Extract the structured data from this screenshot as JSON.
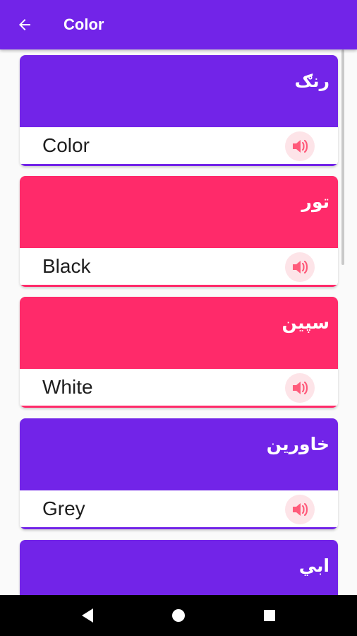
{
  "app_bar": {
    "title": "Color",
    "back_icon": "arrow-left-icon"
  },
  "colors": {
    "primary": "#7224e8",
    "accent": "#ff2a6a",
    "speaker_bg": "#fde4e8"
  },
  "cards": [
    {
      "native": "رنګ",
      "english": "Color",
      "color": "#7224e8"
    },
    {
      "native": "تور",
      "english": "Black",
      "color": "#ff2a6a"
    },
    {
      "native": "سپین",
      "english": "White",
      "color": "#ff2a6a"
    },
    {
      "native": "خاورين",
      "english": "Grey",
      "color": "#7224e8"
    },
    {
      "native": "ابي",
      "english": "",
      "color": "#7224e8"
    }
  ],
  "nav": {
    "back_icon": "triangle-back-icon",
    "home_icon": "circle-home-icon",
    "recents_icon": "square-recents-icon"
  }
}
